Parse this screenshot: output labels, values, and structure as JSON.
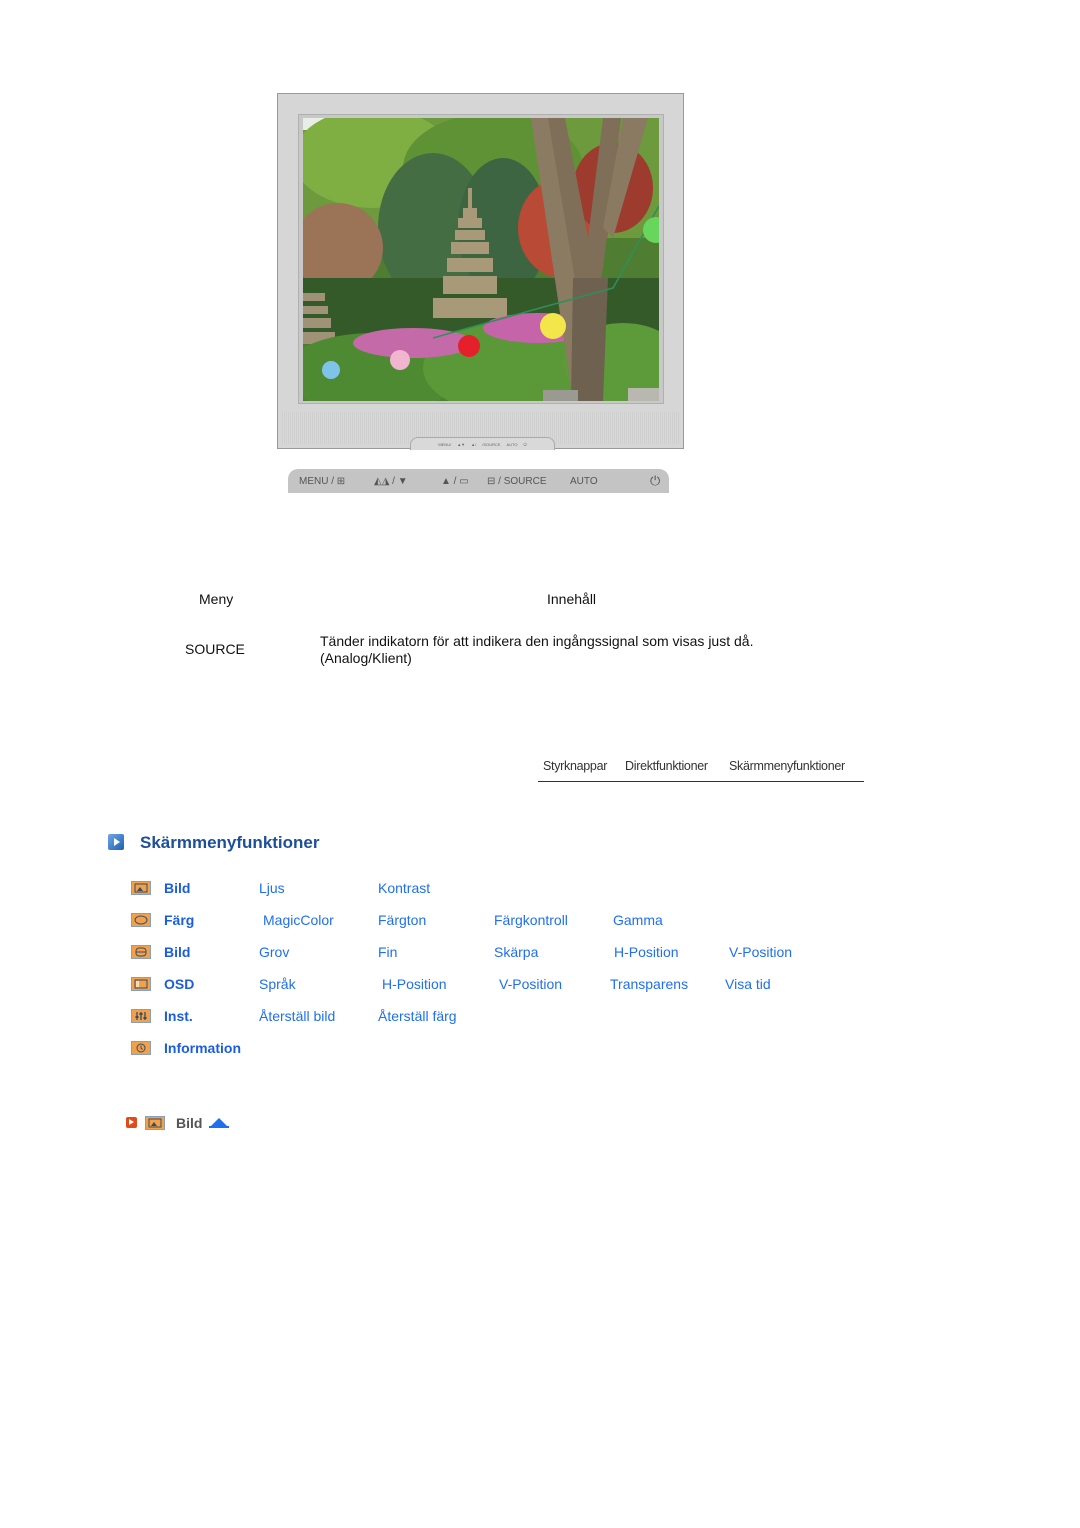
{
  "monitor": {
    "image_alt": "Garden with stone pagoda and paper lanterns",
    "mini_panel_labels": [
      "MENU/",
      "▲▼",
      "▲/",
      "/SOURCE",
      "AUTO",
      "⏻"
    ]
  },
  "control_strip": {
    "buttons": [
      {
        "label": "MENU / ⊞",
        "icon": "menu-icon"
      },
      {
        "label": "◭◮ / ▼",
        "icon": "brightness-down-icon"
      },
      {
        "label": "▲ / ▭",
        "icon": "up-icon"
      },
      {
        "label": "⊟ / SOURCE",
        "icon": "source-icon"
      },
      {
        "label": "AUTO",
        "icon": ""
      },
      {
        "label": "⏻",
        "icon": "power-icon"
      }
    ]
  },
  "table": {
    "header_menu": "Meny",
    "header_content": "Innehåll",
    "rows": [
      {
        "menu": "SOURCE",
        "content_line1": "Tänder indikatorn för att indikera den ingångssignal som visas just då.",
        "content_line2": "(Analog/Klient)"
      }
    ]
  },
  "tabs": [
    "Styrknappar",
    "Direktfunktioner",
    "Skärmmenyfunktioner"
  ],
  "section": {
    "title": "Skärmmenyfunktioner"
  },
  "menu": [
    {
      "category": "Bild",
      "icon": "picture-icon",
      "items": [
        "Ljus",
        "Kontrast"
      ]
    },
    {
      "category": "Färg",
      "icon": "color-icon",
      "items": [
        "MagicColor",
        "Färgton",
        "Färgkontroll",
        "Gamma"
      ]
    },
    {
      "category": "Bild",
      "icon": "image-position-icon",
      "items": [
        "Grov",
        "Fin",
        "Skärpa",
        "H-Position",
        "V-Position"
      ]
    },
    {
      "category": "OSD",
      "icon": "osd-icon",
      "items": [
        "Språk",
        "H-Position",
        "V-Position",
        "Transparens",
        "Visa tid"
      ]
    },
    {
      "category": "Inst.",
      "icon": "setup-icon",
      "items": [
        "Återställ bild",
        "Återställ färg"
      ]
    },
    {
      "category": "Information",
      "icon": "information-icon",
      "items": []
    }
  ],
  "footer": {
    "label": "Bild"
  },
  "colors": {
    "link": "#1f6ff0",
    "category": "#1a5de0",
    "heading": "#1c4f9c",
    "icon_fill": "#f0a14a",
    "red_marker": "#e24a1a"
  }
}
